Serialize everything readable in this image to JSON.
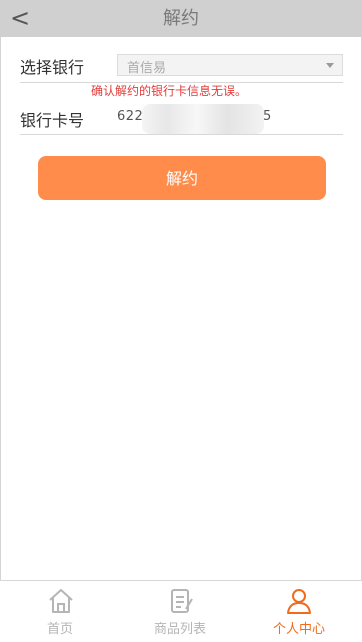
{
  "header": {
    "back_icon": "<",
    "title": "解约"
  },
  "form": {
    "bank_label": "选择银行",
    "bank_selected": "首信易",
    "warning": "确认解约的银行卡信息无误。",
    "card_label": "银行卡号",
    "card_prefix": "622",
    "card_suffix": "5",
    "submit_label": "解约"
  },
  "tabbar": {
    "items": [
      {
        "label": "首页",
        "icon": "home-icon",
        "active": false
      },
      {
        "label": "商品列表",
        "icon": "list-icon",
        "active": false
      },
      {
        "label": "个人中心",
        "icon": "user-icon",
        "active": true
      }
    ]
  },
  "colors": {
    "accent": "#ff8c4a",
    "active_tab": "#f26b1d",
    "inactive_tab": "#b5b5b5",
    "warning": "#e23b3b",
    "header_bg": "#d0d0d0"
  }
}
